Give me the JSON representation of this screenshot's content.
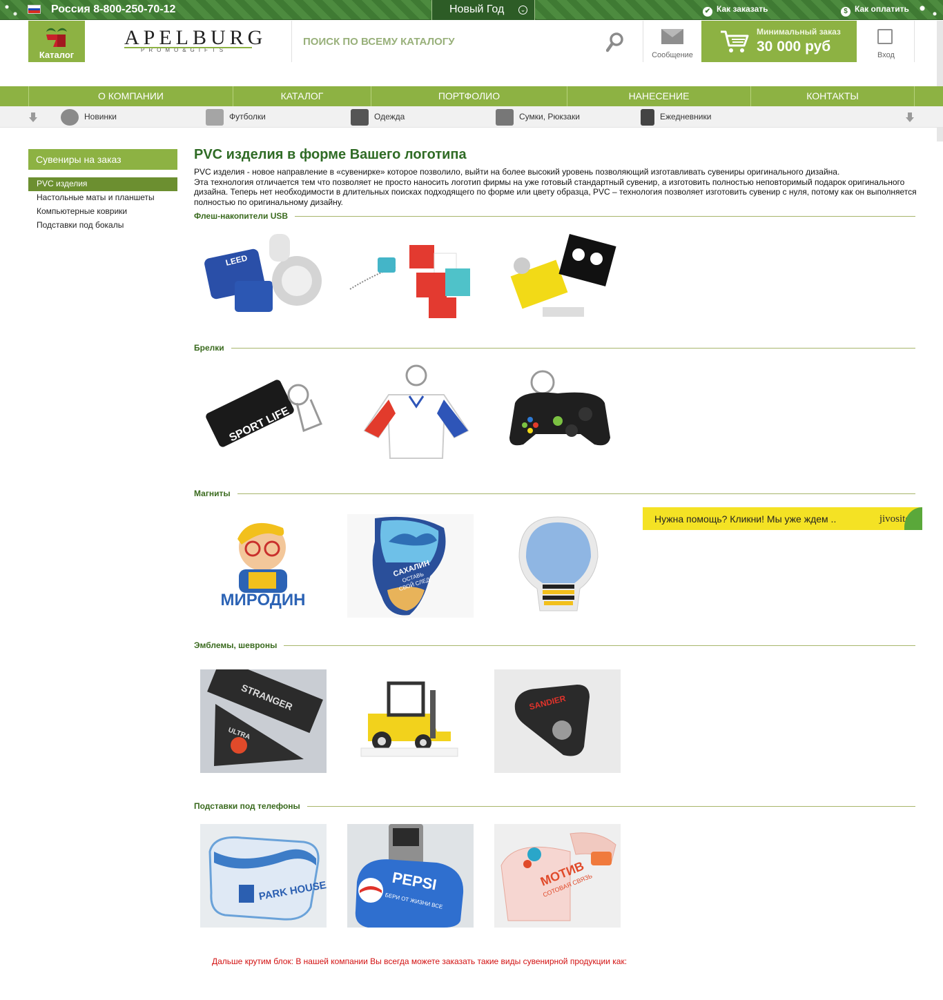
{
  "topbar": {
    "phone": "Россия 8-800-250-70-12",
    "new_year": "Новый Год",
    "how_to_order": "Как заказать",
    "how_to_pay": "Как оплатить",
    "flag_colors": [
      "#ffffff",
      "#1c47b8",
      "#d52b1e"
    ]
  },
  "header": {
    "catalog_label": "Каталог",
    "brand_name": "APELBURG",
    "brand_sub": "PROMO&GIFTS",
    "search_placeholder": "ПОИСК ПО ВСЕМУ КАТАЛОГУ",
    "message_label": "Сообщение",
    "min_order_title": "Минимальный заказ",
    "min_order_value": "30 000 руб",
    "login_label": "Вход"
  },
  "main_nav": [
    "О КОМПАНИИ",
    "КАТАЛОГ",
    "ПОРТФОЛИО",
    "НАНЕСЕНИЕ",
    "КОНТАКТЫ"
  ],
  "sub_nav": [
    {
      "label": "Новинки",
      "icon": "new-badge-icon"
    },
    {
      "label": "Футболки",
      "icon": "tshirt-icon"
    },
    {
      "label": "Одежда",
      "icon": "jacket-icon"
    },
    {
      "label": "Сумки, Рюкзаки",
      "icon": "bag-icon"
    },
    {
      "label": "Ежедневники",
      "icon": "notebook-icon"
    }
  ],
  "sidebar": {
    "heading": "Сувениры на заказ",
    "items": [
      "PVC изделия",
      "Настольные маты и планшеты",
      "Компьютерные коврики",
      "Подставки под бокалы"
    ],
    "active_index": 0
  },
  "content": {
    "title": "PVC изделия в форме Вашего логотипа",
    "intro_1": "PVC изделия - новое направление в «сувенирке» которое позволило, выйти на более высокий уровень позволяющий изготавливать сувениры оригинального дизайна.",
    "intro_2": "Эта технология отличается тем что позволяет не просто наносить логотип фирмы на уже готовый стандартный сувенир, а изготовить полностью неповторимый подарок оригинального дизайна. Теперь нет необходимости в длительных поисках подходящего по форме или цвету образца, PVC – технология позволяет изготовить сувенир с нуля, потому как он выполняется полностью по оригинальному дизайну.",
    "sections": [
      {
        "title": "Флеш-накопители USB"
      },
      {
        "title": "Брелки"
      },
      {
        "title": "Магниты"
      },
      {
        "title": "Эмблемы, шевроны"
      },
      {
        "title": "Подставки под телефоны"
      }
    ],
    "image_texts": {
      "flash1": "LEED",
      "keychain1": "SPORT LIFE",
      "magnet1": "МИРОДИН",
      "magnet2": "САХАЛИН",
      "magnet2_sub1": "ОСТАВЬ",
      "magnet2_sub2": "СВОЙ СЛЕД",
      "emblem1": "STRANGER",
      "emblem1b": "ULTRA",
      "emblem3": "SANDIER",
      "stand1": "PARK HOUSE",
      "stand2": "PEPSI",
      "stand2_sub": "БЕРИ ОТ ЖИЗНИ ВСЕ",
      "stand3": "МОТИВ",
      "stand3_sub": "СОТОВАЯ СВЯЗЬ"
    },
    "footnote": "Дальше крутим блок: В нашей компании Вы всегда можете заказать такие виды сувенирной продукции как:"
  },
  "chat_widget": {
    "text": "Нужна помощь? Кликни! Мы уже ждем ..",
    "brand": "jivosite"
  },
  "colors": {
    "accent_green": "#8db243",
    "dark_green": "#2f6b25",
    "footnote_red": "#d21010",
    "chat_yellow": "#f4e224"
  }
}
